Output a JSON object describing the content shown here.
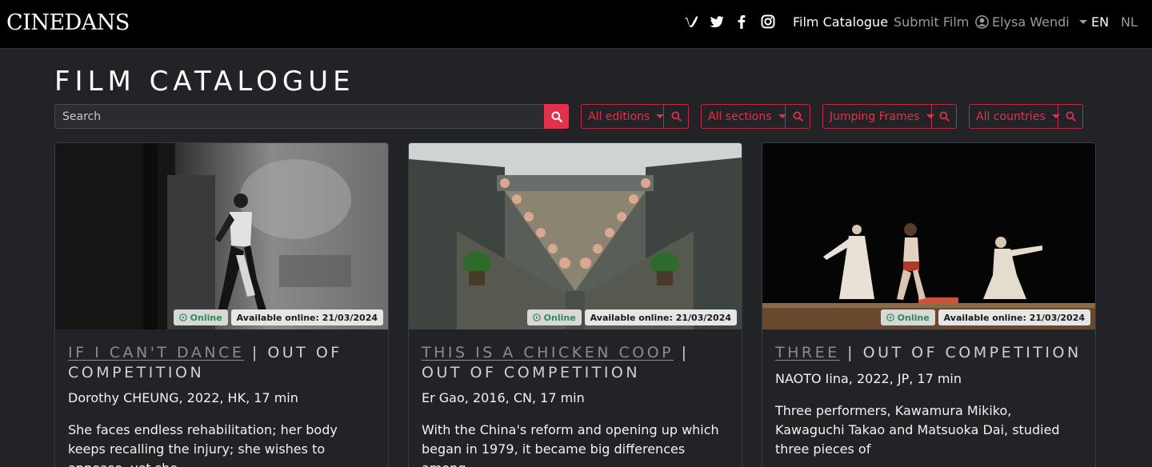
{
  "brand": {
    "logo": "CINEDANS"
  },
  "social": [
    "vimeo-icon",
    "twitter-icon",
    "facebook-icon",
    "instagram-icon"
  ],
  "nav": {
    "film_catalogue": "Film Catalogue",
    "submit_film": "Submit Film",
    "user_name": "Elysa Wendi",
    "lang_en": "EN",
    "lang_nl": "NL"
  },
  "page": {
    "title": "FILM CATALOGUE"
  },
  "search": {
    "placeholder": "Search"
  },
  "filters": {
    "editions": "All editions",
    "sections": "All sections",
    "program": "Jumping Frames",
    "countries": "All countries"
  },
  "colors": {
    "accent": "#e0324b",
    "online_green": "#2e8b57",
    "background": "#222326",
    "topbar": "#000000"
  },
  "films": [
    {
      "title": "IF I CAN'T DANCE",
      "separator": "|",
      "category": "OUT OF COMPETITION",
      "online_label": "Online",
      "available": "Available online: 21/03/2024",
      "meta": "Dorothy CHEUNG, 2022, HK, 17 min",
      "description": "She faces endless rehabilitation; her body keeps recalling the injury; she wishes to appease, yet she"
    },
    {
      "title": "THIS IS A CHICKEN COOP",
      "separator": "|",
      "category": "OUT OF COMPETITION",
      "online_label": "Online",
      "available": "Available online: 21/03/2024",
      "meta": "Er Gao, 2016, CN, 17 min",
      "description": "With the China's reform and opening up which began in 1979, it became big differences among"
    },
    {
      "title": "THREE",
      "separator": "|",
      "category": "OUT OF COMPETITION",
      "online_label": "Online",
      "available": "Available online: 21/03/2024",
      "meta": "NAOTO Iina, 2022, JP, 17 min",
      "description": "Three performers, Kawamura Mikiko, Kawaguchi Takao and Matsuoka Dai, studied three pieces of"
    }
  ]
}
